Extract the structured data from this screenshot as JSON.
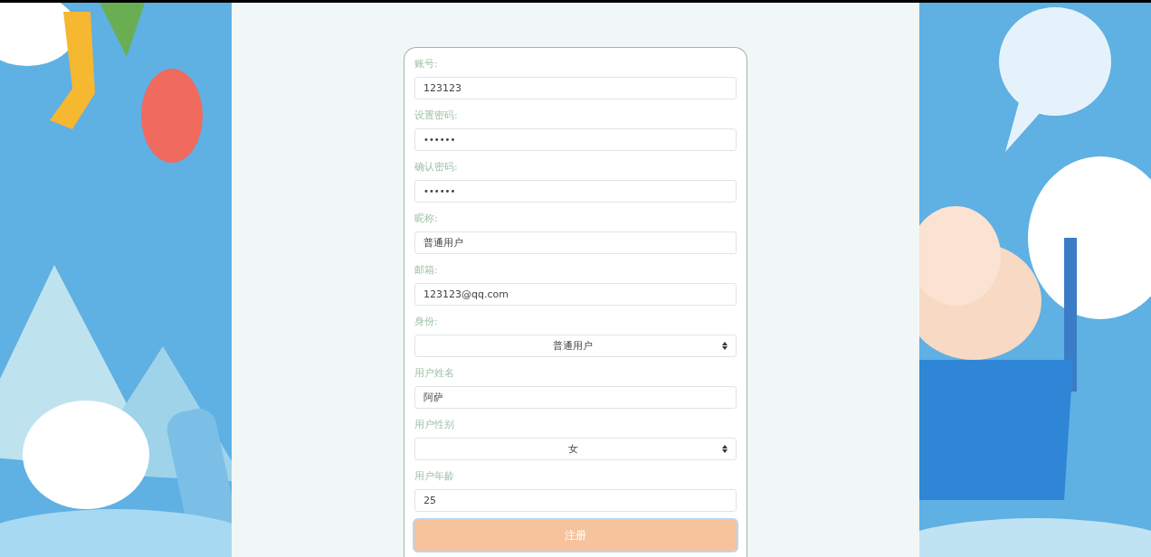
{
  "form": {
    "fields": [
      {
        "label": "账号:",
        "kind": "text",
        "value": "123123"
      },
      {
        "label": "设置密码:",
        "kind": "password",
        "value": "••••••"
      },
      {
        "label": "确认密码:",
        "kind": "password",
        "value": "••••••"
      },
      {
        "label": "昵称:",
        "kind": "text",
        "value": "普通用户"
      },
      {
        "label": "邮箱:",
        "kind": "text",
        "value": "123123@qq.com"
      },
      {
        "label": "身份:",
        "kind": "select",
        "value": "普通用户"
      },
      {
        "label": "用户姓名",
        "kind": "text",
        "value": "阿萨"
      },
      {
        "label": "用户性别",
        "kind": "select",
        "value": "女"
      },
      {
        "label": "用户年龄",
        "kind": "text",
        "value": "25"
      }
    ],
    "submit": {
      "label": "注册",
      "focused": true
    }
  }
}
